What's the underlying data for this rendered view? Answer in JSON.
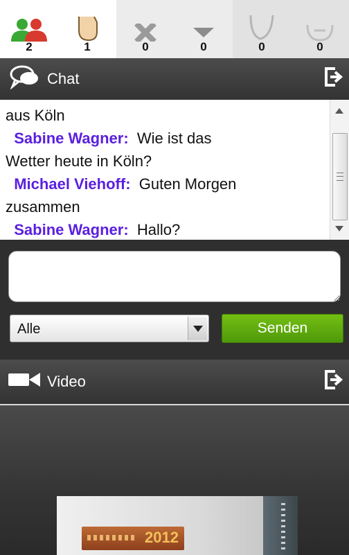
{
  "reactions": [
    {
      "icon": "users-icon",
      "count": "2"
    },
    {
      "icon": "hand-icon",
      "count": "1"
    },
    {
      "icon": "no-icon",
      "count": "0"
    },
    {
      "icon": "down-icon",
      "count": "0"
    },
    {
      "icon": "tooth-icon",
      "count": "0"
    },
    {
      "icon": "smiley-icon",
      "count": "0"
    }
  ],
  "chat": {
    "title": "Chat",
    "lines": {
      "l1": "aus Köln",
      "sender1": "Sabine Wagner:",
      "msg1": "Wie ist das",
      "l3": "Wetter heute in Köln?",
      "sender2": "Michael Viehoff:",
      "msg2": "Guten Morgen",
      "l5": "zusammen",
      "sender3": "Sabine Wagner:",
      "msg3": "Hallo?"
    }
  },
  "composer": {
    "recipient": "Alle",
    "send_label": "Senden"
  },
  "video": {
    "title": "Video",
    "badge_text": "2012"
  },
  "colors": {
    "sender": "#5b1fe0",
    "send_button": "#5ea80e",
    "header_bg": "#3c3c3c"
  }
}
